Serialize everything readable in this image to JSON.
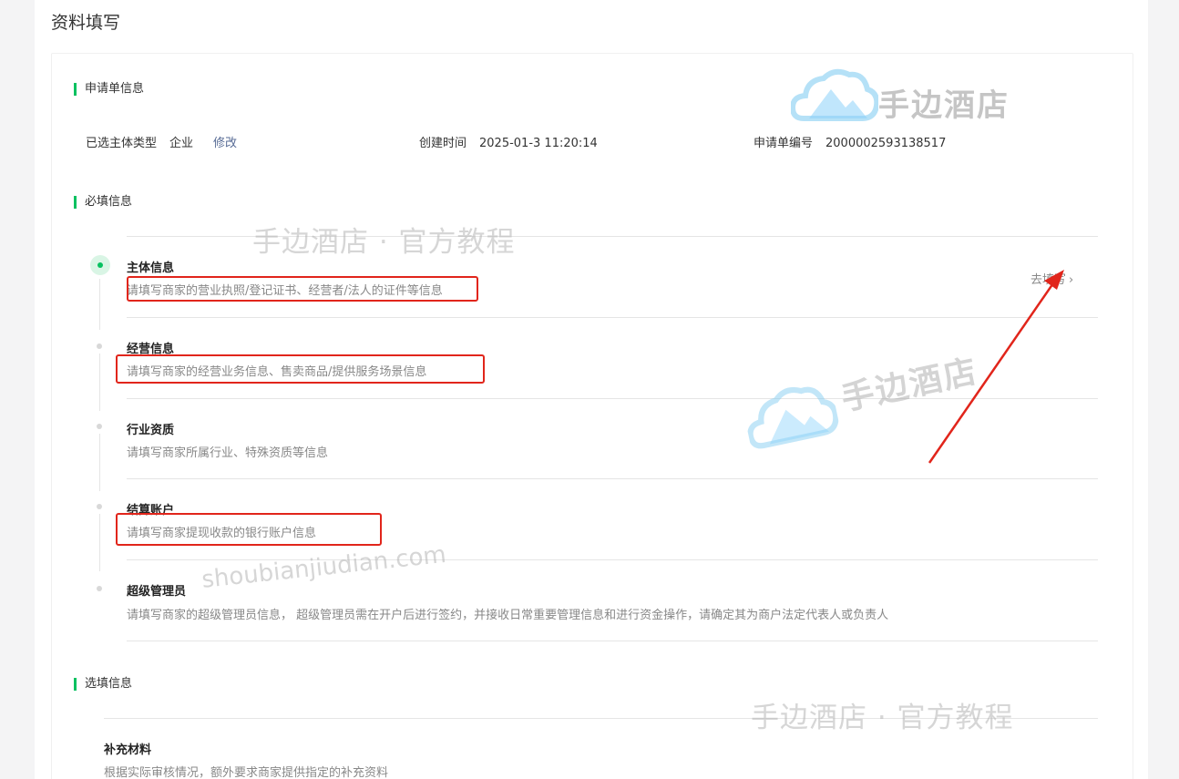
{
  "page_title": "资料填写",
  "sections": {
    "application_info": "申请单信息",
    "required_info": "必填信息",
    "optional_info": "选填信息"
  },
  "application": {
    "subject_type_label": "已选主体类型",
    "subject_type_value": "企业",
    "modify_link": "修改",
    "created_label": "创建时间",
    "created_value": "2025-01-3 11:20:14",
    "app_no_label": "申请单编号",
    "app_no_value": "2000002593138517"
  },
  "steps": [
    {
      "title": "主体信息",
      "desc": "请填写商家的营业执照/登记证书、经营者/法人的证件等信息",
      "active": true
    },
    {
      "title": "经营信息",
      "desc": "请填写商家的经营业务信息、售卖商品/提供服务场景信息",
      "active": false
    },
    {
      "title": "行业资质",
      "desc": "请填写商家所属行业、特殊资质等信息",
      "active": false
    },
    {
      "title": "结算账户",
      "desc": "请填写商家提现收款的银行账户信息",
      "active": false
    },
    {
      "title": "超级管理员",
      "desc": "请填写商家的超级管理员信息， 超级管理员需在开户后进行签约，并接收日常重要管理信息和进行资金操作，请确定其为商户法定代表人或负责人",
      "active": false
    }
  ],
  "goto_fill": "去填写",
  "optional": {
    "title": "补充材料",
    "desc": "根据实际审核情况，额外要求商家提供指定的补充资料"
  },
  "watermarks": {
    "brand": "手边酒店",
    "tutorial": "手边酒店 · 官方教程",
    "domain": "shoubianjiudian.com"
  },
  "colors": {
    "accent": "#07c160",
    "link": "#576b95",
    "annotation_red": "#e1251b"
  },
  "icons": {
    "chevron": "chevron-right-icon",
    "logo": "cloud-mountain-logo"
  }
}
